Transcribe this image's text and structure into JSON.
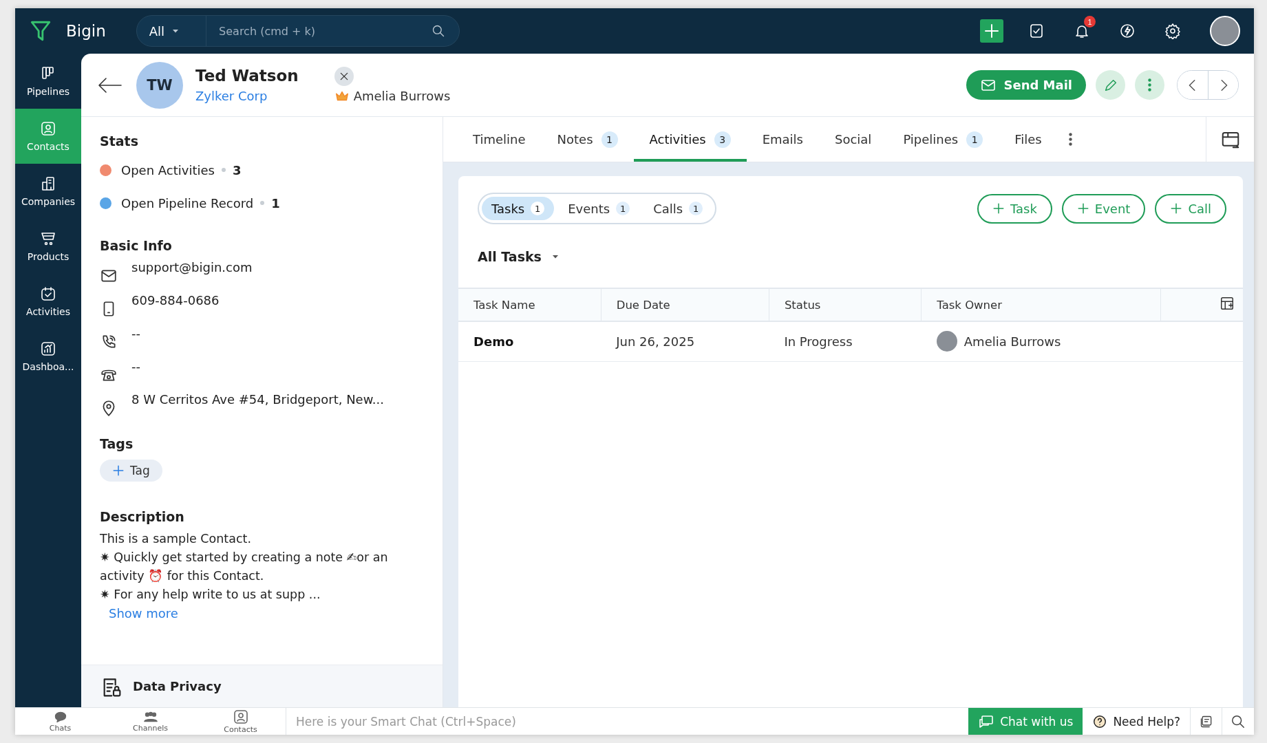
{
  "topbar": {
    "brand": "Bigin",
    "search_scope": "All",
    "search_placeholder": "Search (cmd + k)",
    "notification_count": "1"
  },
  "nav": [
    {
      "label": "Pipelines",
      "kind": "pipelines",
      "selected": false
    },
    {
      "label": "Contacts",
      "kind": "contacts",
      "selected": true
    },
    {
      "label": "Companies",
      "kind": "companies",
      "selected": false
    },
    {
      "label": "Products",
      "kind": "products",
      "selected": false
    },
    {
      "label": "Activities",
      "kind": "activities",
      "selected": false
    },
    {
      "label": "Dashboa...",
      "kind": "dashboards",
      "selected": false
    }
  ],
  "contact": {
    "initials": "TW",
    "name": "Ted Watson",
    "company": "Zylker Corp",
    "owner": "Amelia Burrows"
  },
  "header_actions": {
    "send_mail": "Send Mail"
  },
  "stats": {
    "title": "Stats",
    "items": [
      {
        "label": "Open Activities",
        "count": "3",
        "color": "#f08a6f"
      },
      {
        "label": "Open Pipeline Record",
        "count": "1",
        "color": "#5aa5e6"
      }
    ]
  },
  "basic_info": {
    "title": "Basic Info",
    "fields": [
      {
        "kind": "email",
        "value": "support@bigin.com"
      },
      {
        "kind": "mobile",
        "value": "609-884-0686"
      },
      {
        "kind": "phone",
        "value": "--"
      },
      {
        "kind": "landline",
        "value": "--"
      },
      {
        "kind": "address",
        "value": "8 W Cerritos Ave #54, Bridgeport, New..."
      }
    ]
  },
  "tags": {
    "title": "Tags",
    "add_label": "Tag"
  },
  "description": {
    "title": "Description",
    "lines": [
      "This is a sample Contact.",
      "✷ Quickly get started by creating a note ✍or an activity ⏰ for this Contact.",
      "✷ For any help write to us at supp ..."
    ],
    "show_more": "Show more"
  },
  "data_privacy": "Data Privacy",
  "tabs": [
    {
      "label": "Timeline",
      "selected": false
    },
    {
      "label": "Notes",
      "count": "1",
      "selected": false
    },
    {
      "label": "Activities",
      "count": "3",
      "selected": true
    },
    {
      "label": "Emails",
      "selected": false
    },
    {
      "label": "Social",
      "selected": false
    },
    {
      "label": "Pipelines",
      "count": "1",
      "selected": false
    },
    {
      "label": "Files",
      "selected": false
    }
  ],
  "activity_tabs": [
    {
      "label": "Tasks",
      "count": "1",
      "selected": true
    },
    {
      "label": "Events",
      "count": "1",
      "selected": false
    },
    {
      "label": "Calls",
      "count": "1",
      "selected": false
    }
  ],
  "add_buttons": [
    "Task",
    "Event",
    "Call"
  ],
  "filter": "All Tasks",
  "table": {
    "columns": [
      "Task Name",
      "Due Date",
      "Status",
      "Task Owner"
    ],
    "rows": [
      {
        "task_name": "Demo",
        "due_date": "Jun 26, 2025",
        "status": "In Progress",
        "owner": "Amelia Burrows"
      }
    ]
  },
  "bottom_bar": {
    "items": [
      {
        "label": "Chats",
        "kind": "chats"
      },
      {
        "label": "Channels",
        "kind": "channels"
      },
      {
        "label": "Contacts",
        "kind": "contacts"
      }
    ],
    "chat_placeholder": "Here is your Smart Chat (Ctrl+Space)",
    "chat_button": "Chat with us",
    "help": "Need Help?"
  }
}
